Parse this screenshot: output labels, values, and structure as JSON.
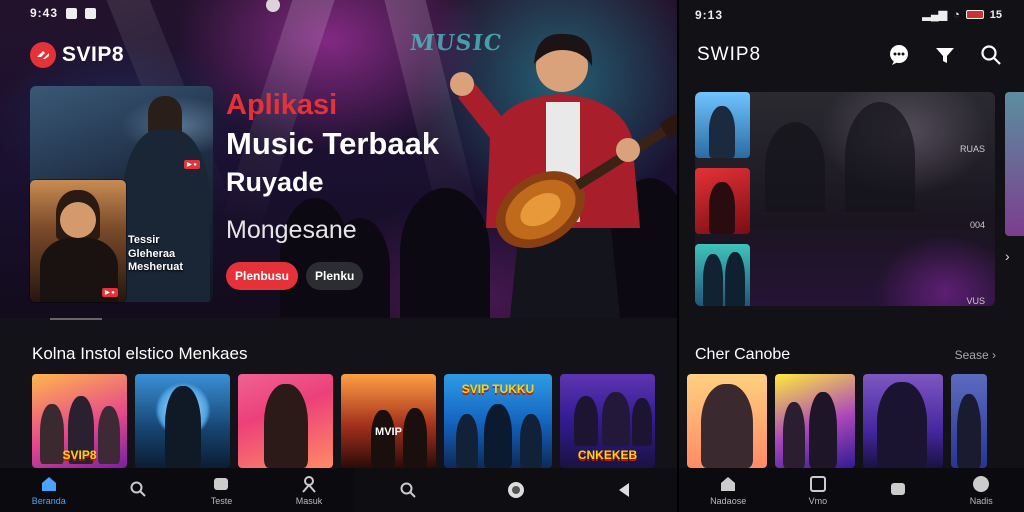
{
  "left": {
    "status_text": "9:43",
    "brand": "SVIP8",
    "hero_sign": "MUSIC",
    "card_caption": [
      "Tessir",
      "Gleheraa",
      "Mesheruat"
    ],
    "headline": {
      "line1": "Aplikasi",
      "line2": "Music Terbaak",
      "line3": "Ruyade",
      "line4": "Mongesane"
    },
    "hero_buttons": {
      "primary": "Plenbusu",
      "secondary": "Plenku"
    },
    "section_title": "Kolna Instol elstico Menkaes",
    "tiles": [
      {
        "label": "SVIP8"
      },
      {
        "label": ""
      },
      {
        "label": ""
      },
      {
        "label": "MVIP"
      },
      {
        "label": "SVIP TUKKU"
      },
      {
        "label": "CNKEKEB"
      }
    ],
    "bottom_nav": [
      {
        "label": "Beranda",
        "icon": "home-icon",
        "active": true
      },
      {
        "label": "",
        "icon": "search-icon",
        "active": false
      },
      {
        "label": "Teste",
        "icon": "library-icon",
        "active": false
      },
      {
        "label": "Masuk",
        "icon": "profile-icon",
        "active": false
      }
    ],
    "system_nav": [
      {
        "icon": "search-icon"
      },
      {
        "icon": "home-circle-icon"
      },
      {
        "icon": "back-icon"
      }
    ]
  },
  "right": {
    "status_text": "9:13",
    "status_right": "15",
    "title": "SWIP8",
    "header_icons": [
      "chat-icon",
      "filter-icon",
      "search-icon"
    ],
    "list_meta": [
      "RUAS",
      "004",
      "VUS"
    ],
    "section_title": "Cher Canobe",
    "more_label": "Sease",
    "bottom_nav": [
      {
        "label": "Nadaose",
        "icon": "home-icon"
      },
      {
        "label": "Vmo",
        "icon": "square-icon"
      },
      {
        "label": "",
        "icon": "library-icon"
      },
      {
        "label": "Nadis",
        "icon": "disc-icon"
      }
    ]
  },
  "colors": {
    "accent": "#e53238",
    "active_nav": "#4aa3ff",
    "tile_text": "#ffd400"
  }
}
